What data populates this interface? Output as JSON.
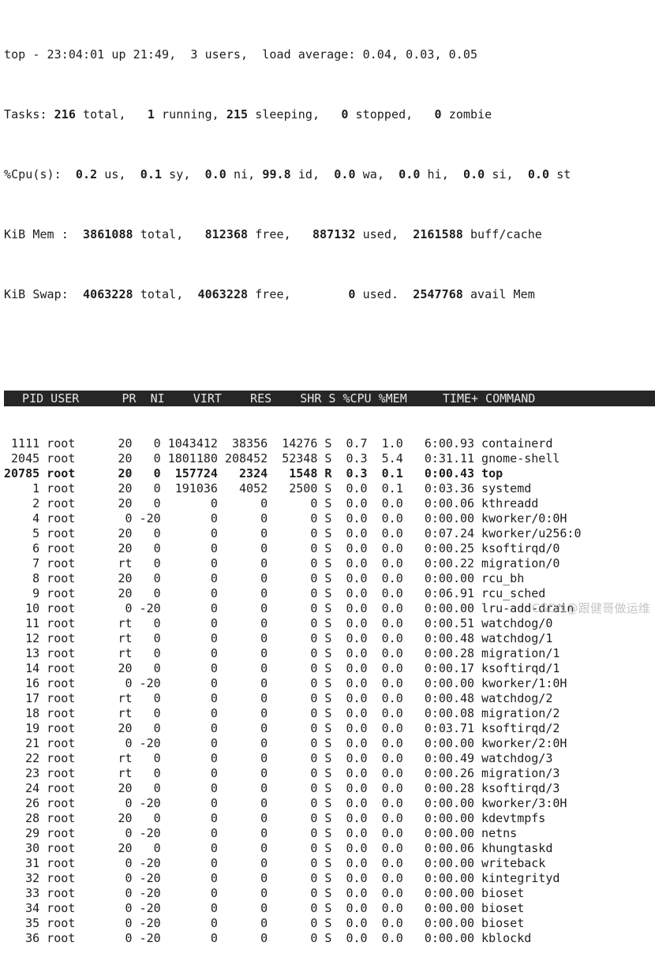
{
  "terminal": {
    "program": "top",
    "colors": {
      "background": "#ffffff",
      "foreground": "#1c1c1c",
      "header_bar_background": "#262626",
      "header_bar_foreground": "#e8e8e8",
      "watermark": "#b9b9b9"
    }
  },
  "summary": {
    "uptime_line": {
      "prefix": "top - ",
      "time": "23:04:01",
      "up_label": " up ",
      "uptime": "21:49,",
      "users": "  3 users,",
      "load_label": "  load average: ",
      "load_avg": "0.04, 0.03, 0.05"
    },
    "tasks_line": {
      "label": "Tasks:",
      "total": "216",
      "total_label": " total,",
      "running": "1",
      "running_label": " running,",
      "sleeping": "215",
      "sleeping_label": " sleeping,",
      "stopped": "0",
      "stopped_label": " stopped,",
      "zombie": "0",
      "zombie_label": " zombie"
    },
    "cpu_line": {
      "label": "%Cpu(s):",
      "us": "0.2",
      "us_label": " us,",
      "sy": "0.1",
      "sy_label": " sy,",
      "ni": "0.0",
      "ni_label": " ni,",
      "id": "99.8",
      "id_label": " id,",
      "wa": "0.0",
      "wa_label": " wa,",
      "hi": "0.0",
      "hi_label": " hi,",
      "si": "0.0",
      "si_label": " si,",
      "st": "0.0",
      "st_label": " st"
    },
    "mem_line": {
      "label": "KiB Mem :",
      "total": "3861088",
      "total_label": " total,",
      "free": "812368",
      "free_label": " free,",
      "used": "887132",
      "used_label": " used,",
      "buff_cache": "2161588",
      "buff_cache_label": " buff/cache"
    },
    "swap_line": {
      "label": "KiB Swap:",
      "total": "4063228",
      "total_label": " total,",
      "free": "4063228",
      "free_label": " free,",
      "used": "0",
      "used_label": " used.",
      "avail": "2547768",
      "avail_label": " avail Mem"
    }
  },
  "table": {
    "header": "  PID USER      PR  NI    VIRT    RES    SHR S %CPU %MEM     TIME+ COMMAND",
    "columns": [
      "PID",
      "USER",
      "PR",
      "NI",
      "VIRT",
      "RES",
      "SHR",
      "S",
      "%CPU",
      "%MEM",
      "TIME+",
      "COMMAND"
    ],
    "rows": [
      {
        "line": " 1111 root      20   0 1043412  38356  14276 S  0.7  1.0   6:00.93 containerd",
        "highlighted": false,
        "pid": "1111",
        "user": "root",
        "pr": "20",
        "ni": "0",
        "virt": "1043412",
        "res": "38356",
        "shr": "14276",
        "s": "S",
        "cpu": "0.7",
        "mem": "1.0",
        "time": "6:00.93",
        "command": "containerd"
      },
      {
        "line": " 2045 root      20   0 1801180 208452  52348 S  0.3  5.4   0:31.11 gnome-shell",
        "highlighted": false,
        "pid": "2045",
        "user": "root",
        "pr": "20",
        "ni": "0",
        "virt": "1801180",
        "res": "208452",
        "shr": "52348",
        "s": "S",
        "cpu": "0.3",
        "mem": "5.4",
        "time": "0:31.11",
        "command": "gnome-shell"
      },
      {
        "line": "20785 root      20   0  157724   2324   1548 R  0.3  0.1   0:00.43 top",
        "highlighted": true,
        "pid": "20785",
        "user": "root",
        "pr": "20",
        "ni": "0",
        "virt": "157724",
        "res": "2324",
        "shr": "1548",
        "s": "R",
        "cpu": "0.3",
        "mem": "0.1",
        "time": "0:00.43",
        "command": "top"
      },
      {
        "line": "    1 root      20   0  191036   4052   2500 S  0.0  0.1   0:03.36 systemd",
        "highlighted": false,
        "pid": "1",
        "user": "root",
        "pr": "20",
        "ni": "0",
        "virt": "191036",
        "res": "4052",
        "shr": "2500",
        "s": "S",
        "cpu": "0.0",
        "mem": "0.1",
        "time": "0:03.36",
        "command": "systemd"
      },
      {
        "line": "    2 root      20   0       0      0      0 S  0.0  0.0   0:00.06 kthreadd",
        "highlighted": false,
        "pid": "2",
        "user": "root",
        "pr": "20",
        "ni": "0",
        "virt": "0",
        "res": "0",
        "shr": "0",
        "s": "S",
        "cpu": "0.0",
        "mem": "0.0",
        "time": "0:00.06",
        "command": "kthreadd"
      },
      {
        "line": "    4 root       0 -20       0      0      0 S  0.0  0.0   0:00.00 kworker/0:0H",
        "highlighted": false,
        "pid": "4",
        "user": "root",
        "pr": "0",
        "ni": "-20",
        "virt": "0",
        "res": "0",
        "shr": "0",
        "s": "S",
        "cpu": "0.0",
        "mem": "0.0",
        "time": "0:00.00",
        "command": "kworker/0:0H"
      },
      {
        "line": "    5 root      20   0       0      0      0 S  0.0  0.0   0:07.24 kworker/u256:0",
        "highlighted": false,
        "pid": "5",
        "user": "root",
        "pr": "20",
        "ni": "0",
        "virt": "0",
        "res": "0",
        "shr": "0",
        "s": "S",
        "cpu": "0.0",
        "mem": "0.0",
        "time": "0:07.24",
        "command": "kworker/u256:0"
      },
      {
        "line": "    6 root      20   0       0      0      0 S  0.0  0.0   0:00.25 ksoftirqd/0",
        "highlighted": false,
        "pid": "6",
        "user": "root",
        "pr": "20",
        "ni": "0",
        "virt": "0",
        "res": "0",
        "shr": "0",
        "s": "S",
        "cpu": "0.0",
        "mem": "0.0",
        "time": "0:00.25",
        "command": "ksoftirqd/0"
      },
      {
        "line": "    7 root      rt   0       0      0      0 S  0.0  0.0   0:00.22 migration/0",
        "highlighted": false,
        "pid": "7",
        "user": "root",
        "pr": "rt",
        "ni": "0",
        "virt": "0",
        "res": "0",
        "shr": "0",
        "s": "S",
        "cpu": "0.0",
        "mem": "0.0",
        "time": "0:00.22",
        "command": "migration/0"
      },
      {
        "line": "    8 root      20   0       0      0      0 S  0.0  0.0   0:00.00 rcu_bh",
        "highlighted": false,
        "pid": "8",
        "user": "root",
        "pr": "20",
        "ni": "0",
        "virt": "0",
        "res": "0",
        "shr": "0",
        "s": "S",
        "cpu": "0.0",
        "mem": "0.0",
        "time": "0:00.00",
        "command": "rcu_bh"
      },
      {
        "line": "    9 root      20   0       0      0      0 S  0.0  0.0   0:06.91 rcu_sched",
        "highlighted": false,
        "pid": "9",
        "user": "root",
        "pr": "20",
        "ni": "0",
        "virt": "0",
        "res": "0",
        "shr": "0",
        "s": "S",
        "cpu": "0.0",
        "mem": "0.0",
        "time": "0:06.91",
        "command": "rcu_sched"
      },
      {
        "line": "   10 root       0 -20       0      0      0 S  0.0  0.0   0:00.00 lru-add-drain",
        "highlighted": false,
        "pid": "10",
        "user": "root",
        "pr": "0",
        "ni": "-20",
        "virt": "0",
        "res": "0",
        "shr": "0",
        "s": "S",
        "cpu": "0.0",
        "mem": "0.0",
        "time": "0:00.00",
        "command": "lru-add-drain"
      },
      {
        "line": "   11 root      rt   0       0      0      0 S  0.0  0.0   0:00.51 watchdog/0",
        "highlighted": false,
        "pid": "11",
        "user": "root",
        "pr": "rt",
        "ni": "0",
        "virt": "0",
        "res": "0",
        "shr": "0",
        "s": "S",
        "cpu": "0.0",
        "mem": "0.0",
        "time": "0:00.51",
        "command": "watchdog/0"
      },
      {
        "line": "   12 root      rt   0       0      0      0 S  0.0  0.0   0:00.48 watchdog/1",
        "highlighted": false,
        "pid": "12",
        "user": "root",
        "pr": "rt",
        "ni": "0",
        "virt": "0",
        "res": "0",
        "shr": "0",
        "s": "S",
        "cpu": "0.0",
        "mem": "0.0",
        "time": "0:00.48",
        "command": "watchdog/1"
      },
      {
        "line": "   13 root      rt   0       0      0      0 S  0.0  0.0   0:00.28 migration/1",
        "highlighted": false,
        "pid": "13",
        "user": "root",
        "pr": "rt",
        "ni": "0",
        "virt": "0",
        "res": "0",
        "shr": "0",
        "s": "S",
        "cpu": "0.0",
        "mem": "0.0",
        "time": "0:00.28",
        "command": "migration/1"
      },
      {
        "line": "   14 root      20   0       0      0      0 S  0.0  0.0   0:00.17 ksoftirqd/1",
        "highlighted": false,
        "pid": "14",
        "user": "root",
        "pr": "20",
        "ni": "0",
        "virt": "0",
        "res": "0",
        "shr": "0",
        "s": "S",
        "cpu": "0.0",
        "mem": "0.0",
        "time": "0:00.17",
        "command": "ksoftirqd/1"
      },
      {
        "line": "   16 root       0 -20       0      0      0 S  0.0  0.0   0:00.00 kworker/1:0H",
        "highlighted": false,
        "pid": "16",
        "user": "root",
        "pr": "0",
        "ni": "-20",
        "virt": "0",
        "res": "0",
        "shr": "0",
        "s": "S",
        "cpu": "0.0",
        "mem": "0.0",
        "time": "0:00.00",
        "command": "kworker/1:0H"
      },
      {
        "line": "   17 root      rt   0       0      0      0 S  0.0  0.0   0:00.48 watchdog/2",
        "highlighted": false,
        "pid": "17",
        "user": "root",
        "pr": "rt",
        "ni": "0",
        "virt": "0",
        "res": "0",
        "shr": "0",
        "s": "S",
        "cpu": "0.0",
        "mem": "0.0",
        "time": "0:00.48",
        "command": "watchdog/2"
      },
      {
        "line": "   18 root      rt   0       0      0      0 S  0.0  0.0   0:00.08 migration/2",
        "highlighted": false,
        "pid": "18",
        "user": "root",
        "pr": "rt",
        "ni": "0",
        "virt": "0",
        "res": "0",
        "shr": "0",
        "s": "S",
        "cpu": "0.0",
        "mem": "0.0",
        "time": "0:00.08",
        "command": "migration/2"
      },
      {
        "line": "   19 root      20   0       0      0      0 S  0.0  0.0   0:03.71 ksoftirqd/2",
        "highlighted": false,
        "pid": "19",
        "user": "root",
        "pr": "20",
        "ni": "0",
        "virt": "0",
        "res": "0",
        "shr": "0",
        "s": "S",
        "cpu": "0.0",
        "mem": "0.0",
        "time": "0:03.71",
        "command": "ksoftirqd/2"
      },
      {
        "line": "   21 root       0 -20       0      0      0 S  0.0  0.0   0:00.00 kworker/2:0H",
        "highlighted": false,
        "pid": "21",
        "user": "root",
        "pr": "0",
        "ni": "-20",
        "virt": "0",
        "res": "0",
        "shr": "0",
        "s": "S",
        "cpu": "0.0",
        "mem": "0.0",
        "time": "0:00.00",
        "command": "kworker/2:0H"
      },
      {
        "line": "   22 root      rt   0       0      0      0 S  0.0  0.0   0:00.49 watchdog/3",
        "highlighted": false,
        "pid": "22",
        "user": "root",
        "pr": "rt",
        "ni": "0",
        "virt": "0",
        "res": "0",
        "shr": "0",
        "s": "S",
        "cpu": "0.0",
        "mem": "0.0",
        "time": "0:00.49",
        "command": "watchdog/3"
      },
      {
        "line": "   23 root      rt   0       0      0      0 S  0.0  0.0   0:00.26 migration/3",
        "highlighted": false,
        "pid": "23",
        "user": "root",
        "pr": "rt",
        "ni": "0",
        "virt": "0",
        "res": "0",
        "shr": "0",
        "s": "S",
        "cpu": "0.0",
        "mem": "0.0",
        "time": "0:00.26",
        "command": "migration/3"
      },
      {
        "line": "   24 root      20   0       0      0      0 S  0.0  0.0   0:00.28 ksoftirqd/3",
        "highlighted": false,
        "pid": "24",
        "user": "root",
        "pr": "20",
        "ni": "0",
        "virt": "0",
        "res": "0",
        "shr": "0",
        "s": "S",
        "cpu": "0.0",
        "mem": "0.0",
        "time": "0:00.28",
        "command": "ksoftirqd/3"
      },
      {
        "line": "   26 root       0 -20       0      0      0 S  0.0  0.0   0:00.00 kworker/3:0H",
        "highlighted": false,
        "pid": "26",
        "user": "root",
        "pr": "0",
        "ni": "-20",
        "virt": "0",
        "res": "0",
        "shr": "0",
        "s": "S",
        "cpu": "0.0",
        "mem": "0.0",
        "time": "0:00.00",
        "command": "kworker/3:0H"
      },
      {
        "line": "   28 root      20   0       0      0      0 S  0.0  0.0   0:00.00 kdevtmpfs",
        "highlighted": false,
        "pid": "28",
        "user": "root",
        "pr": "20",
        "ni": "0",
        "virt": "0",
        "res": "0",
        "shr": "0",
        "s": "S",
        "cpu": "0.0",
        "mem": "0.0",
        "time": "0:00.00",
        "command": "kdevtmpfs"
      },
      {
        "line": "   29 root       0 -20       0      0      0 S  0.0  0.0   0:00.00 netns",
        "highlighted": false,
        "pid": "29",
        "user": "root",
        "pr": "0",
        "ni": "-20",
        "virt": "0",
        "res": "0",
        "shr": "0",
        "s": "S",
        "cpu": "0.0",
        "mem": "0.0",
        "time": "0:00.00",
        "command": "netns"
      },
      {
        "line": "   30 root      20   0       0      0      0 S  0.0  0.0   0:00.06 khungtaskd",
        "highlighted": false,
        "pid": "30",
        "user": "root",
        "pr": "20",
        "ni": "0",
        "virt": "0",
        "res": "0",
        "shr": "0",
        "s": "S",
        "cpu": "0.0",
        "mem": "0.0",
        "time": "0:00.06",
        "command": "khungtaskd"
      },
      {
        "line": "   31 root       0 -20       0      0      0 S  0.0  0.0   0:00.00 writeback",
        "highlighted": false,
        "pid": "31",
        "user": "root",
        "pr": "0",
        "ni": "-20",
        "virt": "0",
        "res": "0",
        "shr": "0",
        "s": "S",
        "cpu": "0.0",
        "mem": "0.0",
        "time": "0:00.00",
        "command": "writeback"
      },
      {
        "line": "   32 root       0 -20       0      0      0 S  0.0  0.0   0:00.00 kintegrityd",
        "highlighted": false,
        "pid": "32",
        "user": "root",
        "pr": "0",
        "ni": "-20",
        "virt": "0",
        "res": "0",
        "shr": "0",
        "s": "S",
        "cpu": "0.0",
        "mem": "0.0",
        "time": "0:00.00",
        "command": "kintegrityd"
      },
      {
        "line": "   33 root       0 -20       0      0      0 S  0.0  0.0   0:00.00 bioset",
        "highlighted": false,
        "pid": "33",
        "user": "root",
        "pr": "0",
        "ni": "-20",
        "virt": "0",
        "res": "0",
        "shr": "0",
        "s": "S",
        "cpu": "0.0",
        "mem": "0.0",
        "time": "0:00.00",
        "command": "bioset"
      },
      {
        "line": "   34 root       0 -20       0      0      0 S  0.0  0.0   0:00.00 bioset",
        "highlighted": false,
        "pid": "34",
        "user": "root",
        "pr": "0",
        "ni": "-20",
        "virt": "0",
        "res": "0",
        "shr": "0",
        "s": "S",
        "cpu": "0.0",
        "mem": "0.0",
        "time": "0:00.00",
        "command": "bioset"
      },
      {
        "line": "   35 root       0 -20       0      0      0 S  0.0  0.0   0:00.00 bioset",
        "highlighted": false,
        "pid": "35",
        "user": "root",
        "pr": "0",
        "ni": "-20",
        "virt": "0",
        "res": "0",
        "shr": "0",
        "s": "S",
        "cpu": "0.0",
        "mem": "0.0",
        "time": "0:00.00",
        "command": "bioset"
      },
      {
        "line": "   36 root       0 -20       0      0      0 S  0.0  0.0   0:00.00 kblockd",
        "highlighted": false,
        "pid": "36",
        "user": "root",
        "pr": "0",
        "ni": "-20",
        "virt": "0",
        "res": "0",
        "shr": "0",
        "s": "S",
        "cpu": "0.0",
        "mem": "0.0",
        "time": "0:00.00",
        "command": "kblockd"
      }
    ]
  },
  "watermark": {
    "text": "CSDN@跟健哥做运维"
  }
}
